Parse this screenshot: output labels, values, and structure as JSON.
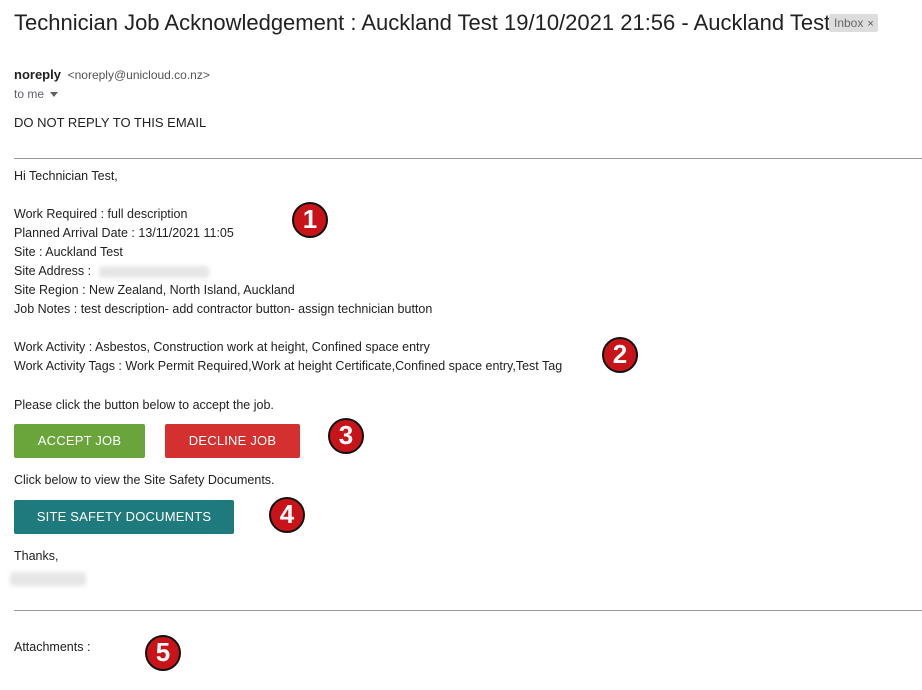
{
  "email": {
    "subject": "Technician Job Acknowledgement : Auckland Test 19/10/2021 21:56 - Auckland Test",
    "label_chip": "Inbox",
    "label_close": "×",
    "sender_name": "noreply",
    "sender_email": "<noreply@unicloud.co.nz>",
    "recipient": "to me",
    "notice": "DO NOT REPLY TO THIS EMAIL"
  },
  "body": {
    "greeting": "Hi Technician Test,",
    "work_required": "Work Required : full description",
    "planned_arrival": "Planned Arrival Date : 13/11/2021 11:05",
    "site": "Site : Auckland Test",
    "site_address_label": "Site Address :",
    "site_region": "Site Region : New Zealand, North Island, Auckland",
    "job_notes": "Job Notes : test description- add contractor button- assign technician button",
    "work_activity": "Work Activity : Asbestos, Construction work at height, Confined space entry",
    "work_activity_tags": "Work Activity Tags : Work Permit Required,Work at height Certificate,Confined space entry,Test Tag",
    "accept_prompt": "Please click the button below to accept the job.",
    "accept_button": "ACCEPT JOB",
    "decline_button": "DECLINE JOB",
    "docs_prompt": "Click below to view the Site Safety Documents.",
    "docs_button": "SITE SAFETY DOCUMENTS",
    "thanks": "Thanks,",
    "attachments_label": "Attachments :"
  },
  "markers": [
    "1",
    "2",
    "3",
    "4",
    "5"
  ],
  "colors": {
    "accept": "#6aa53b",
    "decline": "#d3302f",
    "docs": "#1f7a7d",
    "marker": "#c81418"
  }
}
